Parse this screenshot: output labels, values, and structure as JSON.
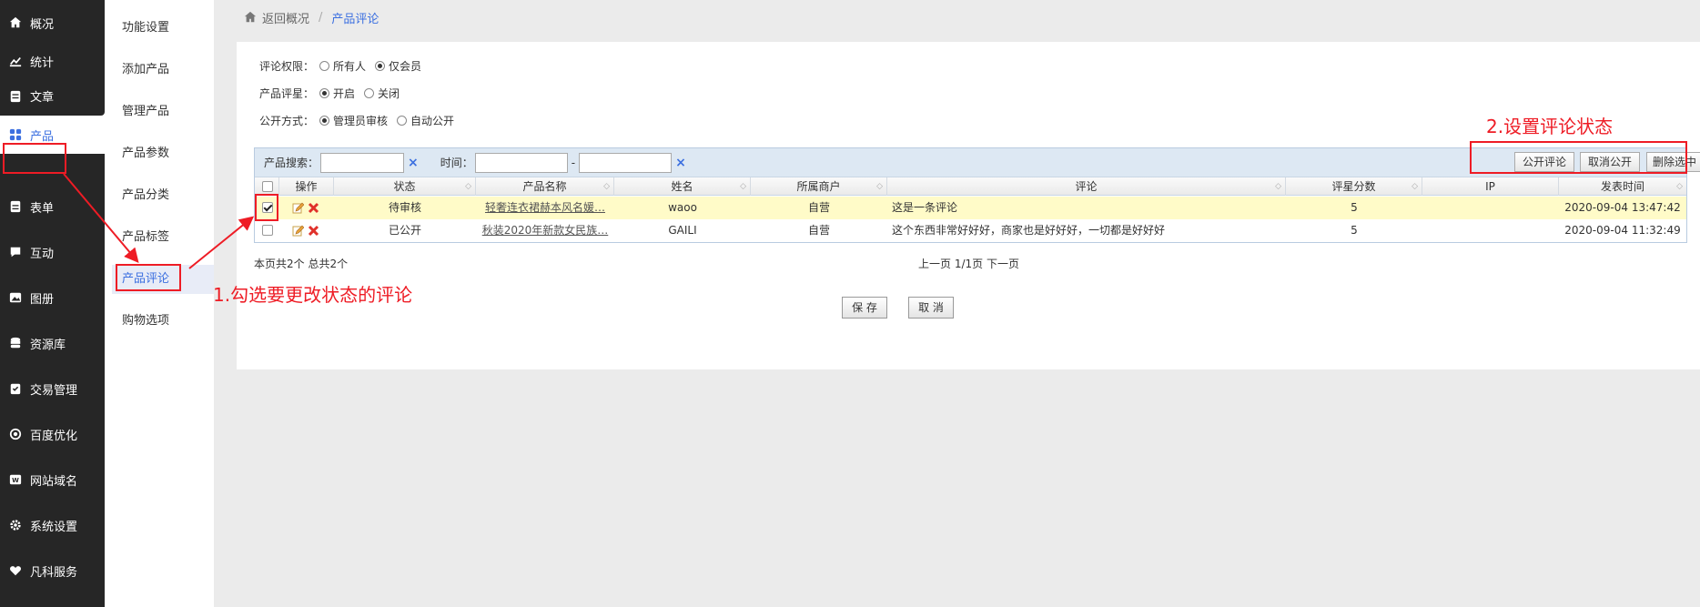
{
  "sidebar": {
    "items": [
      {
        "label": "概况",
        "icon": "home-icon"
      },
      {
        "label": "统计",
        "icon": "chart-icon"
      },
      {
        "label": "文章",
        "icon": "article-icon"
      },
      {
        "label": "产品",
        "icon": "grid-icon"
      },
      {
        "label": "表单",
        "icon": "form-icon"
      },
      {
        "label": "互动",
        "icon": "chat-icon"
      },
      {
        "label": "图册",
        "icon": "gallery-icon"
      },
      {
        "label": "资源库",
        "icon": "database-icon"
      },
      {
        "label": "交易管理",
        "icon": "trade-icon"
      },
      {
        "label": "百度优化",
        "icon": "seo-icon"
      },
      {
        "label": "网站域名",
        "icon": "domain-icon"
      },
      {
        "label": "系统设置",
        "icon": "gear-icon"
      },
      {
        "label": "凡科服务",
        "icon": "heart-icon"
      }
    ]
  },
  "submenu": {
    "items": [
      "功能设置",
      "添加产品",
      "管理产品",
      "产品参数",
      "产品分类",
      "产品标签",
      "产品评论",
      "购物选项"
    ]
  },
  "breadcrumb": {
    "back": "返回概况",
    "separator": "/",
    "current": "产品评论"
  },
  "options": {
    "permission": {
      "label": "评论权限：",
      "choices": [
        "所有人",
        "仅会员"
      ],
      "selected": "仅会员"
    },
    "rating": {
      "label": "产品评星：",
      "choices": [
        "开启",
        "关闭"
      ],
      "selected": "开启"
    },
    "publish": {
      "label": "公开方式：",
      "choices": [
        "管理员审核",
        "自动公开"
      ],
      "selected": "管理员审核"
    }
  },
  "toolbar": {
    "search_label": "产品搜索：",
    "time_label": "时间：",
    "time_dash": "-",
    "clear_symbol": "×",
    "buttons": [
      "公开评论",
      "取消公开",
      "删除选中"
    ]
  },
  "table": {
    "columns": [
      "操作",
      "状态",
      "产品名称",
      "姓名",
      "所属商户",
      "评论",
      "评星分数",
      "IP",
      "发表时间"
    ],
    "rows": [
      {
        "checked": true,
        "status": "待审核",
        "product": "轻奢连衣裙赫本风名媛…",
        "name": "waoo",
        "merchant": "自营",
        "comment": "这是一条评论",
        "score": "5",
        "ip": "",
        "time": "2020-09-04 13:47:42"
      },
      {
        "checked": false,
        "status": "已公开",
        "product": "秋装2020年新款女民族…",
        "name": "GAILI",
        "merchant": "自营",
        "comment": "这个东西非常好好好，商家也是好好好，一切都是好好好",
        "score": "5",
        "ip": "",
        "time": "2020-09-04 11:32:49"
      }
    ]
  },
  "pager": {
    "summary": "本页共2个 总共2个",
    "prev": "上一页",
    "pages": "1/1页",
    "next": "下一页"
  },
  "footer": {
    "save": "保 存",
    "cancel": "取 消"
  },
  "annotations": {
    "step1": "1.勾选要更改状态的评论",
    "step2": "2.设置评论状态"
  },
  "colors": {
    "accent": "#3b6fe0",
    "annotation": "#ee1c25",
    "sidebar_bg": "#262626",
    "highlight_row": "#fffbc8"
  }
}
